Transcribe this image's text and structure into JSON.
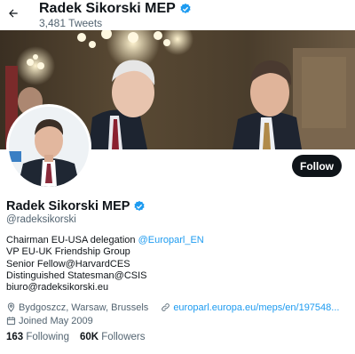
{
  "header": {
    "name": "Radek Sikorski MEP",
    "tweet_count": "3,481 Tweets"
  },
  "profile": {
    "name": "Radek Sikorski MEP",
    "handle": "@radeksikorski",
    "follow_label": "Follow",
    "bio": {
      "line1_text": "Chairman EU-USA delegation ",
      "line1_link": "@Europarl_EN",
      "line2": "VP EU-UK Friendship Group",
      "line3": "Senior Fellow@HarvardCES",
      "line4": "Distinguished Statesman@CSIS",
      "line5": "biuro@radeksikorski.eu"
    },
    "location": "Bydgoszcz, Warsaw, Brussels",
    "website": "europarl.europa.eu/meps/en/197548...",
    "joined": "Joined May 2009",
    "following_count": "163",
    "following_label": "Following",
    "followers_count": "60K",
    "followers_label": "Followers"
  },
  "colors": {
    "accent": "#1d9bf0",
    "text": "#0f1419",
    "secondary": "#536471",
    "button": "#0f1419"
  },
  "icons": {
    "back": "arrow-left-icon",
    "verified": "verified-badge-icon",
    "location": "location-pin-icon",
    "link": "link-icon",
    "calendar": "calendar-icon"
  }
}
